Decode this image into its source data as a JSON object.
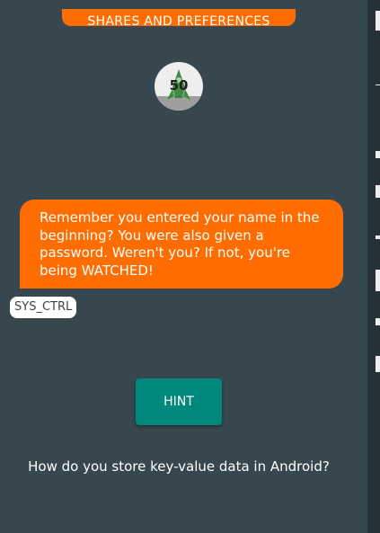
{
  "header": {
    "title": "SHARES AND PREFERENCES"
  },
  "badge": {
    "number": "50",
    "icon": "rocket-icon"
  },
  "message": {
    "text": "Remember you entered your name in the beginning? You were also given a password. Weren't you? If not, you're being WATCHED!",
    "sender": "SYS_CTRL"
  },
  "actions": {
    "hint_label": "HINT"
  },
  "question": {
    "text": "How do you store key-value data in Android?"
  },
  "colors": {
    "background": "#37474f",
    "accent": "#ff6d00",
    "button": "#00897b"
  }
}
